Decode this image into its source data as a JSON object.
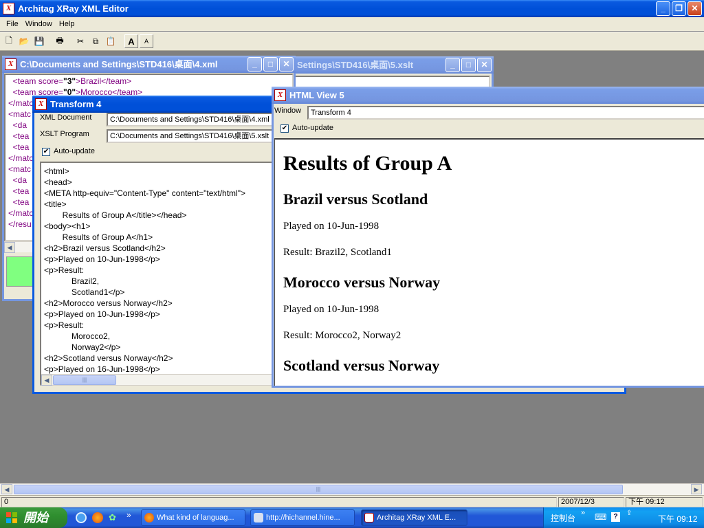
{
  "app": {
    "title": "Architag XRay XML Editor"
  },
  "menu": [
    "File",
    "Window",
    "Help"
  ],
  "xmlwin": {
    "title": "C:\\Documents and Settings\\STD416\\桌面\\4.xml",
    "lines": [
      [
        "  <team score=",
        "\"3\"",
        ">Brazil</team>"
      ],
      [
        "  <team score=",
        "\"0\"",
        ">Morocco</team>"
      ],
      [
        "</matc",
        "",
        ""
      ],
      [
        "<matc",
        "",
        ""
      ],
      [
        "  <da",
        "",
        ""
      ],
      [
        "  <tea",
        "",
        ""
      ],
      [
        "  <tea",
        "",
        ""
      ],
      [
        "</matc",
        "",
        ""
      ],
      [
        "<matc",
        "",
        ""
      ],
      [
        "  <da",
        "",
        ""
      ],
      [
        "  <tea",
        "",
        ""
      ],
      [
        "  <tea",
        "",
        ""
      ],
      [
        "</matc",
        "",
        ""
      ],
      [
        "</resu",
        "",
        ""
      ]
    ]
  },
  "xsltwin": {
    "title": "Settings\\STD416\\桌面\\5.xslt"
  },
  "transform": {
    "title": "Transform 4",
    "xml_label": "XML Document",
    "xml_value": "C:\\Documents and Settings\\STD416\\桌面\\4.xml",
    "xslt_label": "XSLT Program",
    "xslt_value": "C:\\Documents and Settings\\STD416\\桌面\\5.xslt",
    "autoupdate": "Auto-update",
    "output": [
      "<html>",
      "<head>",
      "<META http-equiv=\"Content-Type\" content=\"text/html\">",
      "<title>",
      "        Results of Group A</title></head>",
      "<body><h1>",
      "        Results of Group A</h1>",
      "<h2>Brazil versus Scotland</h2>",
      "<p>Played on 10-Jun-1998</p>",
      "<p>Result:",
      "            Brazil2,",
      "            Scotland1</p>",
      "<h2>Morocco versus Norway</h2>",
      "<p>Played on 10-Jun-1998</p>",
      "<p>Result:",
      "            Morocco2,",
      "            Norway2</p>",
      "<h2>Scotland versus Norway</h2>",
      "<p>Played on 16-Jun-1998</p>"
    ]
  },
  "htmlview": {
    "title": "HTML View 5",
    "window_label": "Window",
    "window_value": "Transform 4",
    "autoupdate": "Auto-update",
    "h1": "Results of Group A",
    "m1_title": "Brazil versus Scotland",
    "m1_played": "Played on 10-Jun-1998",
    "m1_result": "Result: Brazil2, Scotland1",
    "m2_title": "Morocco versus Norway",
    "m2_played": "Played on 10-Jun-1998",
    "m2_result": "Result: Morocco2, Norway2",
    "m3_title": "Scotland versus Norway"
  },
  "status": {
    "left": "0",
    "date": "2007/12/3",
    "time": "下午 09:12"
  },
  "taskbar": {
    "start": "開始",
    "tasks": [
      "What kind of languag...",
      "http://hichannel.hine...",
      "Architag XRay XML E..."
    ],
    "tray_label": "控制台",
    "clock": "下午 09:12"
  }
}
